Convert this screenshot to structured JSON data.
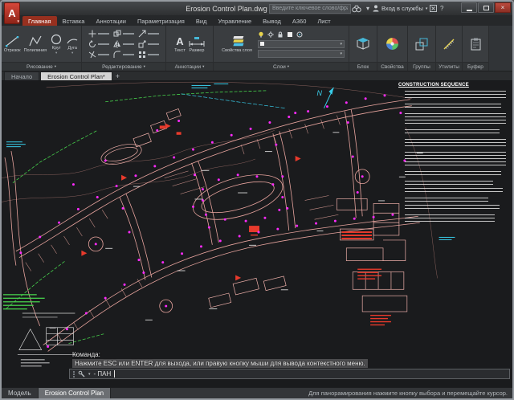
{
  "titlebar": {
    "title": "Erosion Control Plan.dwg",
    "search_placeholder": "Введите ключевое слово/фразу",
    "signin_label": "Вход в службы"
  },
  "icons": {
    "app_logo": "A",
    "caret_down": "▾",
    "close": "×",
    "help": "?",
    "plus": "+",
    "text_tool": "A"
  },
  "ribbon_tabs": [
    {
      "label": "Главная"
    },
    {
      "label": "Вставка"
    },
    {
      "label": "Аннотации"
    },
    {
      "label": "Параметризация"
    },
    {
      "label": "Вид"
    },
    {
      "label": "Управление"
    },
    {
      "label": "Вывод"
    },
    {
      "label": "A360"
    },
    {
      "label": "Лист"
    }
  ],
  "ribbon": {
    "draw_tools": [
      {
        "label": "Отрезок"
      },
      {
        "label": "Полилиния"
      },
      {
        "label": "Круг"
      },
      {
        "label": "Дуга"
      }
    ],
    "text_label": "Текст",
    "dim_label": "Размер",
    "layer_props_label": "Свойства слоя",
    "panel_labels": {
      "draw": "Рисование",
      "modify": "Редактирование",
      "annotation": "Аннотации",
      "layers": "Слои",
      "block": "Блок",
      "properties": "Свойства",
      "groups": "Группы",
      "utilities": "Утилиты",
      "clipboard": "Буфер"
    }
  },
  "file_tabs": [
    {
      "label": "Начало"
    },
    {
      "label": "Erosion Control Plan*"
    }
  ],
  "drawing": {
    "construction_sequence_title": "CONSTRUCTION SEQUENCE",
    "north_label": "N"
  },
  "command": {
    "prompt": "Команда:",
    "message": "Нажмите ESC или ENTER для выхода, или правую кнопку мыши для вывода контекстного меню.",
    "input": "- ПАН"
  },
  "status_bar": {
    "model_tab": "Модель",
    "layout_tab": "Erosion Control Plan",
    "hint": "Для панорамирования нажмите кнопку выбора и перемещайте курсор."
  },
  "colors": {
    "accent_red": "#97301f",
    "road_pink": "#e8a49e",
    "point_magenta": "#ff2bff",
    "fence_green": "#46d14c",
    "utility_cyan": "#38cdea",
    "marker_red": "#e83a2c",
    "model_background": "#1a1b1d"
  }
}
